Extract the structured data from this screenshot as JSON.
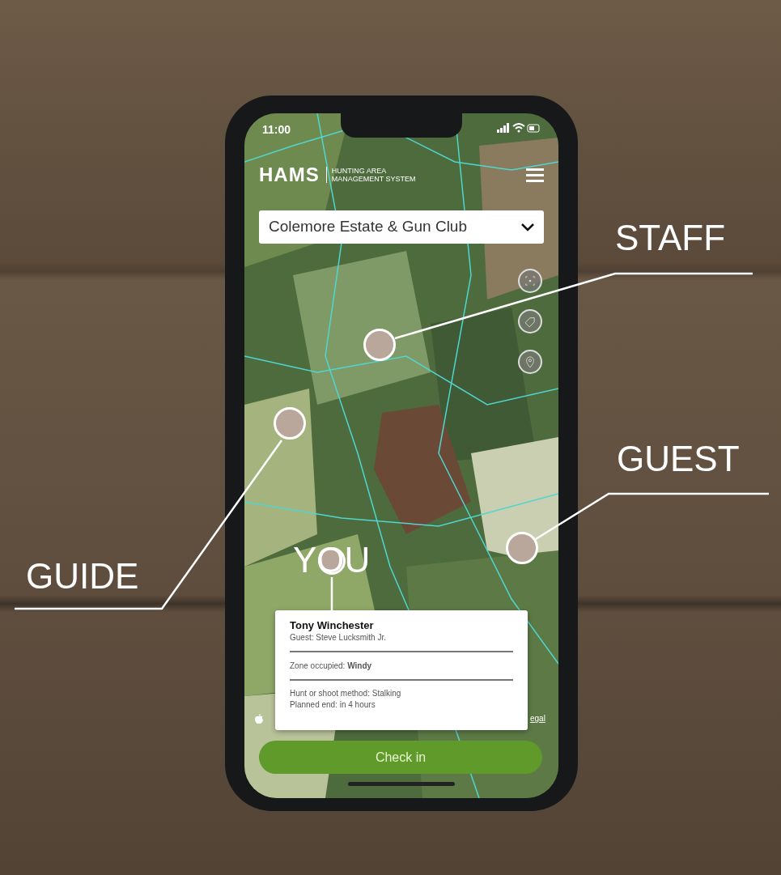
{
  "status_bar": {
    "time": "11:00"
  },
  "app_header": {
    "logo": "HAMS",
    "tagline": [
      "HUNTING AREA",
      "MANAGEMENT SYSTEM"
    ]
  },
  "estate_dropdown": {
    "value": "Colemore Estate & Gun Club"
  },
  "callouts": [
    {
      "label": "STAFF"
    },
    {
      "label": "GUEST"
    },
    {
      "label": "GUIDE"
    },
    {
      "label": "YOU"
    }
  ],
  "info_card": {
    "name": "Tony Winchester",
    "guest": "Guest: Steve Lucksmith Jr.",
    "zone": "Zone occupied: **Windy**",
    "details": [
      "Hunt or shoot method: Stalking",
      "Planned end: in 4 hours"
    ]
  },
  "map_attribution": {
    "legal": "egal"
  },
  "check_in_button": {
    "label": "Check in"
  }
}
